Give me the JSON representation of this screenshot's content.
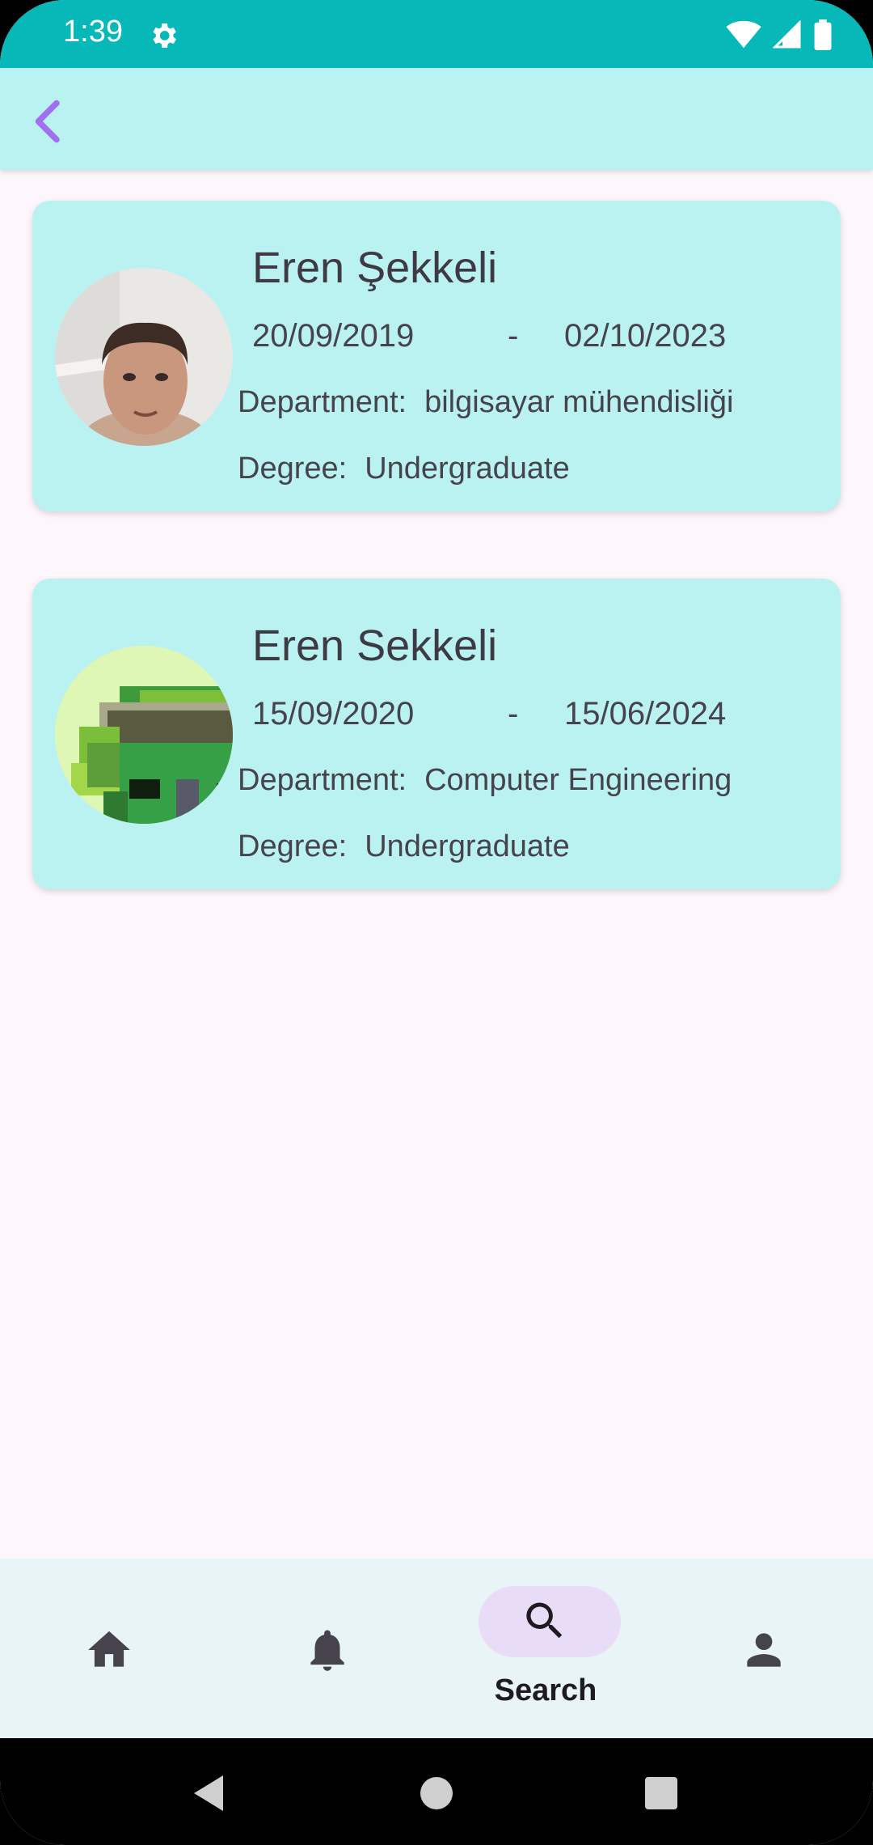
{
  "status_bar": {
    "time": "1:39",
    "icons": [
      "settings-icon",
      "wifi-icon",
      "signal-icon",
      "battery-icon"
    ]
  },
  "app_bar": {
    "back_icon": "chevron-left-icon"
  },
  "results": [
    {
      "name": "Eren Şekkeli",
      "start_date": "20/09/2019",
      "separator": "-",
      "end_date": "02/10/2023",
      "department_label": "Department:",
      "department": "bilgisayar mühendisliği",
      "degree_label": "Degree:",
      "degree": "Undergraduate",
      "avatar": "photo-avatar"
    },
    {
      "name": "Eren Sekkeli",
      "start_date": "15/09/2020",
      "separator": "-",
      "end_date": "15/06/2024",
      "department_label": "Department:",
      "department": "Computer Engineering",
      "degree_label": "Degree:",
      "degree": "Undergraduate",
      "avatar": "pixel-art-avatar"
    }
  ],
  "bottom_nav": {
    "items": [
      {
        "icon": "home-icon",
        "label": ""
      },
      {
        "icon": "bell-icon",
        "label": ""
      },
      {
        "icon": "search-icon",
        "label": "Search",
        "active": true
      },
      {
        "icon": "person-icon",
        "label": ""
      }
    ]
  },
  "colors": {
    "status_bar": "#07b8b9",
    "app_bar": "#baf2f1",
    "card": "#baf2f1",
    "accent": "#a070f0",
    "background": "#fdf7fb",
    "nav_pill": "#e8dcf6"
  }
}
